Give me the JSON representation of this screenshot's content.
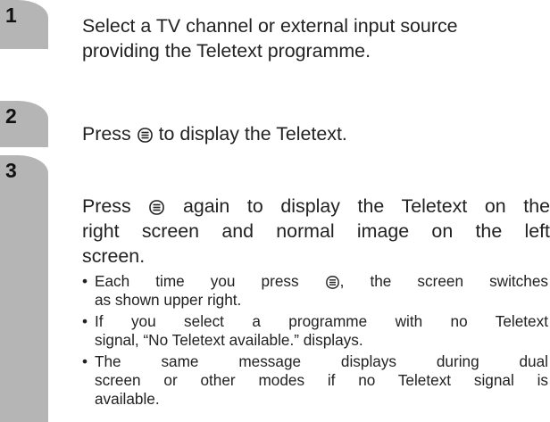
{
  "steps": [
    {
      "number": "1",
      "text_line1": "Select a TV channel or external input source",
      "text_line2": "providing the Teletext programme."
    },
    {
      "number": "2",
      "text_pre": "Press",
      "text_post": "to display the Teletext."
    },
    {
      "number": "3",
      "line1_pre": "Press",
      "line1_post": "again to display the Teletext on the",
      "line2": "right screen and normal image on the left",
      "line3": "screen.",
      "bullets": [
        {
          "line1_pre": "Each time you press",
          "line1_post": ", the screen switches",
          "line2": "as shown upper right."
        },
        {
          "line1": "If you select a programme with no Teletext",
          "line2": "signal, “No Teletext available.” displays."
        },
        {
          "line1": "The same message displays during dual",
          "line2": "screen or other modes if no Teletext signal is",
          "line3": "available."
        }
      ]
    }
  ],
  "bullet_char": "•",
  "icons": {
    "teletext": "teletext-button-icon"
  },
  "colors": {
    "tab": "#b5b5b5",
    "text": "#222222"
  }
}
